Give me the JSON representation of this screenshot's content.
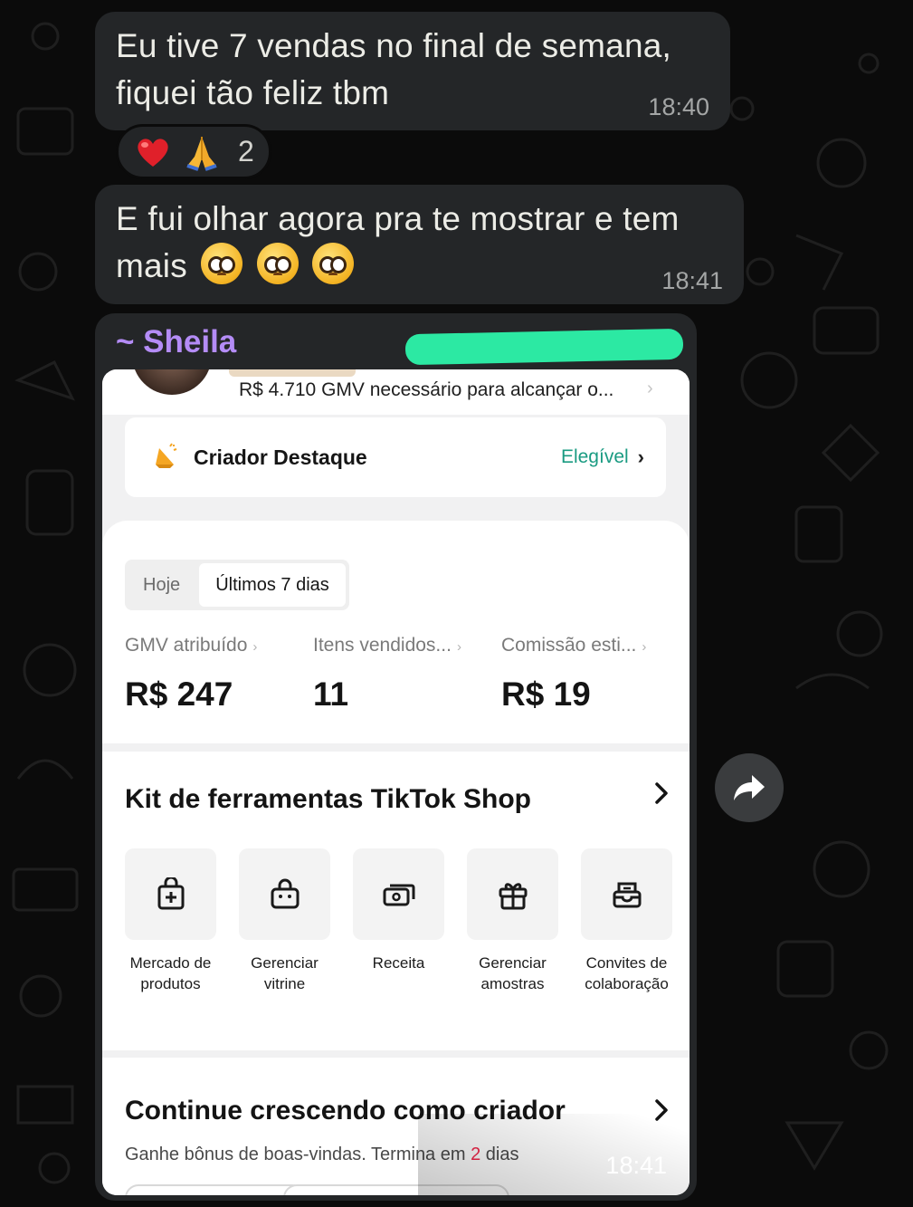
{
  "messages": [
    {
      "text_line1": "Eu tive 7 vendas no final de semana,",
      "text_line2": "fiquei tão feliz tbm",
      "time": "18:40"
    },
    {
      "text_line1": "E fui olhar agora pra te mostrar e tem",
      "text_line2": "mais",
      "time": "18:41"
    }
  ],
  "reactions": {
    "emojis": [
      "red-heart",
      "folded-hands"
    ],
    "count": "2"
  },
  "shared_image": {
    "sender": "~ Sheila",
    "time": "18:41",
    "gmv_note": "R$ 4.710 GMV necessário para alcançar o...",
    "featured": {
      "title": "Criador Destaque",
      "status": "Elegível"
    },
    "tabs": [
      "Hoje",
      "Últimos 7 dias"
    ],
    "selected_tab": "Últimos 7 dias",
    "metrics": [
      {
        "label": "GMV atribuído",
        "value": "R$ 247"
      },
      {
        "label": "Itens vendidos...",
        "value": "11"
      },
      {
        "label": "Comissão esti...",
        "value": "R$ 19"
      }
    ],
    "toolkit": {
      "title": "Kit de ferramentas TikTok Shop",
      "tools": [
        {
          "line1": "Mercado de",
          "line2": "produtos",
          "icon": "bag-plus-icon"
        },
        {
          "line1": "Gerenciar",
          "line2": "vitrine",
          "icon": "shop-bag-icon"
        },
        {
          "line1": "Receita",
          "line2": "",
          "icon": "cash-icon"
        },
        {
          "line1": "Gerenciar",
          "line2": "amostras",
          "icon": "gift-icon"
        },
        {
          "line1": "Convites de",
          "line2": "colaboração",
          "icon": "inbox-icon"
        }
      ]
    },
    "grow": {
      "title": "Continue crescendo como criador",
      "sub_before": "Ganhe bônus de boas-vindas. Termina em ",
      "sub_highlight": "2",
      "sub_after": " dias"
    }
  },
  "colors": {
    "background": "#0b0b0b",
    "bubble": "#242628",
    "sender": "#b48cf6",
    "redaction": "#2ce9a3",
    "eligible": "#1a9b82",
    "highlight": "#f2274b"
  }
}
